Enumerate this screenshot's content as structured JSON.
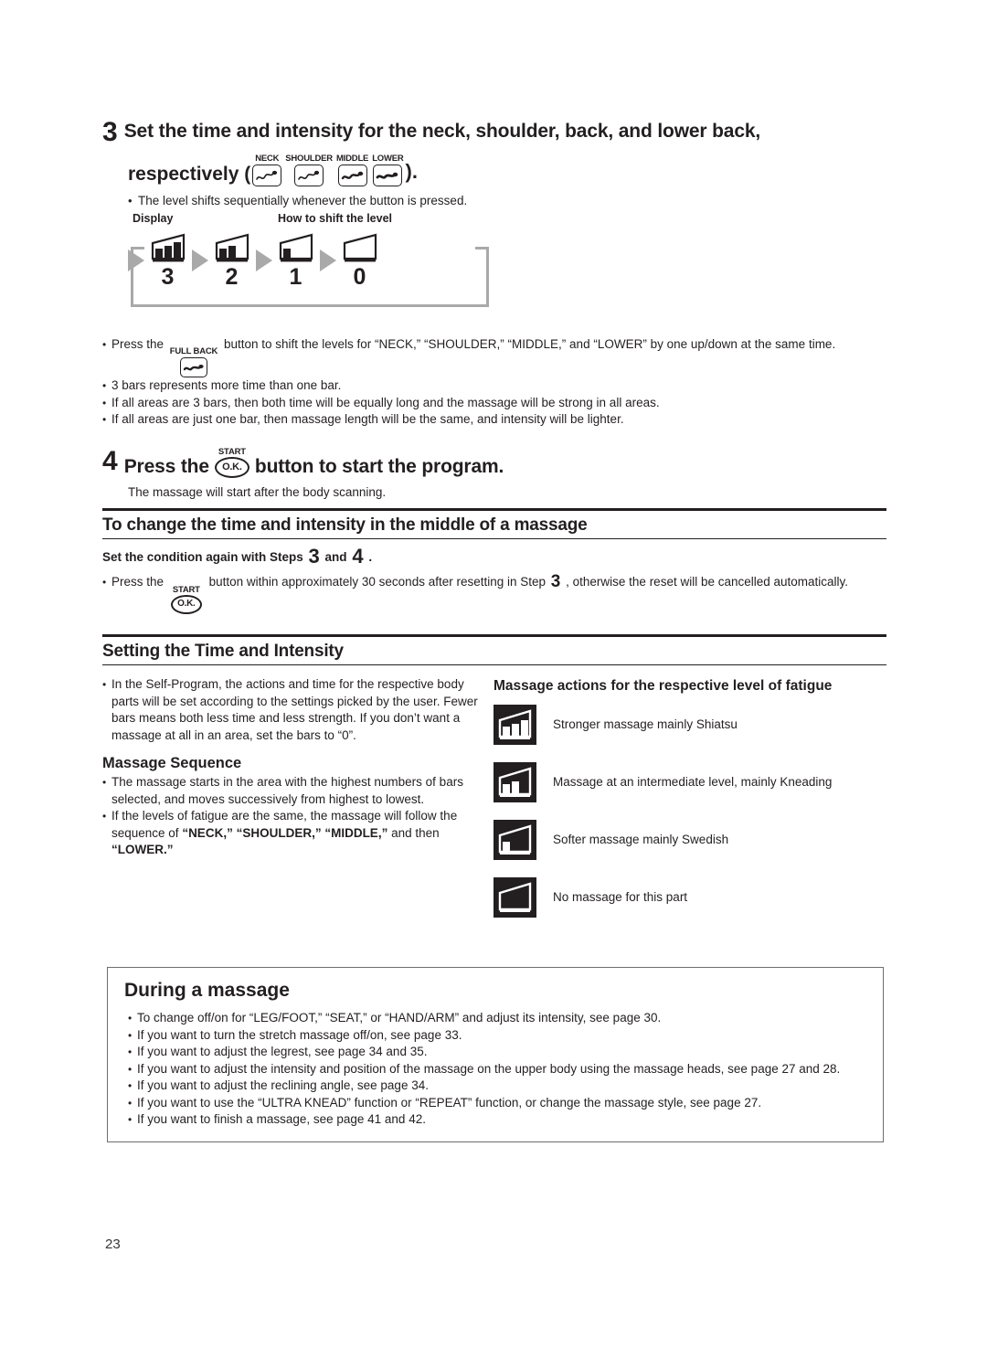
{
  "page_number": "23",
  "step3": {
    "number": "3",
    "title_line1": "Set the time and intensity for the neck, shoulder, back, and lower back,",
    "title_line2_prefix": "respectively (",
    "title_line2_suffix": ").",
    "buttons": [
      {
        "caption": "NECK",
        "icon": "massage-wave-icon"
      },
      {
        "caption": "SHOULDER",
        "icon": "massage-wave-icon"
      },
      {
        "caption": "MIDDLE",
        "icon": "massage-wave-icon"
      },
      {
        "caption": "LOWER",
        "icon": "massage-wave-icon"
      }
    ],
    "note": "The level shifts sequentially whenever the button is pressed.",
    "bullet_dot": "•"
  },
  "diagram": {
    "label_display": "Display",
    "label_howto": "How to shift the level",
    "levels": [
      {
        "value": "3",
        "bars": 3
      },
      {
        "value": "2",
        "bars": 2
      },
      {
        "value": "1",
        "bars": 1
      },
      {
        "value": "0",
        "bars": 0
      }
    ],
    "arrow_color": "#a9a9a9",
    "loop_color": "#a9a9a9"
  },
  "step3_bullets": {
    "fullback_caption": "FULL BACK",
    "b1_pre": "Press the",
    "b1_post": "button to shift the levels for “NECK,” “SHOULDER,” “MIDDLE,” and “LOWER” by one up/down at the same time.",
    "b2": "3 bars represents more time than one bar.",
    "b3": "If all areas are 3 bars, then both time will be equally long and the massage will be strong in all areas.",
    "b4": "If all areas are just one bar, then massage length will be the same, and intensity will be lighter."
  },
  "step4": {
    "number": "4",
    "title_pre": "Press the",
    "title_post": "button to start the program.",
    "ok_label": "O.K.",
    "start_caption": "START",
    "note": "The massage will start after the body scanning."
  },
  "change_section": {
    "heading": "To change the time and intensity in the middle of a massage",
    "line_pre": "Set the condition again with Steps",
    "step_a": "3",
    "line_mid": "and",
    "step_b": "4",
    "line_end": ".",
    "bullet_pre": "Press the",
    "ok_label": "O.K.",
    "start_caption": "START",
    "bullet_mid": "button within approximately 30 seconds after resetting in Step",
    "bullet_step": "3",
    "bullet_end": ", otherwise the reset will be cancelled automatically."
  },
  "setting_section": {
    "heading": "Setting the Time and Intensity",
    "left_bullet": "In the Self-Program, the actions and time for the respective body parts will be set according to the settings picked by the user. Fewer bars means both less time and less strength.  If you don’t want a massage at all in an area, set the bars to “0”.",
    "massage_sequence_heading": "Massage Sequence",
    "seq_b1": "The massage starts in the area with the highest numbers of bars selected, and moves successively from highest to lowest.",
    "seq_b2_pre": "If the levels of fatigue are the same, the massage will follow the sequence of ",
    "seq_b2_bold1": "“NECK,” “SHOULDER,” “MIDDLE,”",
    "seq_b2_mid": " and then ",
    "seq_b2_bold2": "“LOWER.”",
    "right_heading": "Massage actions for the respective level of fatigue",
    "levels": [
      {
        "bars": 3,
        "icon": "level-3-icon",
        "text": "Stronger massage mainly Shiatsu"
      },
      {
        "bars": 2,
        "icon": "level-2-icon",
        "text": "Massage at an intermediate level, mainly Kneading"
      },
      {
        "bars": 1,
        "icon": "level-1-icon",
        "text": "Softer massage mainly Swedish"
      },
      {
        "bars": 0,
        "icon": "level-0-icon",
        "text": "No massage for this part"
      }
    ]
  },
  "during_massage": {
    "heading": "During a massage",
    "bullets": [
      "To change off/on for “LEG/FOOT,” “SEAT,” or “HAND/ARM” and adjust its intensity, see page 30.",
      "If you want to turn the stretch massage off/on, see page 33.",
      "If you want to adjust the legrest, see page 34 and 35.",
      "If you want to adjust the intensity and position of the massage on the upper body using the massage heads, see page 27 and 28.",
      "If you want to adjust the reclining angle, see page 34.",
      "If you want to use the “ULTRA KNEAD” function or “REPEAT” function, or change the massage style, see page 27.",
      "If you want to finish a massage, see page 41 and 42."
    ]
  },
  "colors": {
    "ink": "#231f20",
    "gray": "#a9a9a9",
    "box_border": "#6e6e6e"
  }
}
